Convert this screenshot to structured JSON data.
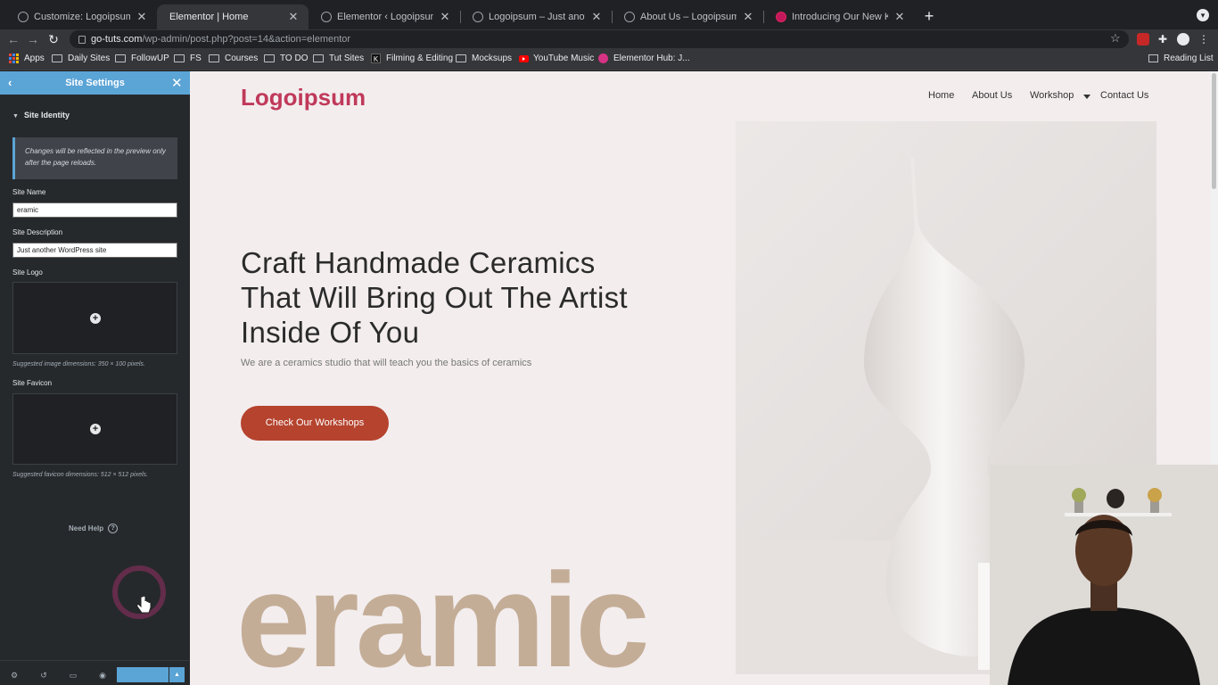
{
  "browser": {
    "tabs": [
      {
        "title": "Customize: Logoipsum – Just a",
        "active": false
      },
      {
        "title": "Elementor | Home",
        "active": true
      },
      {
        "title": "Elementor ‹ Logoipsum — Wo",
        "active": false
      },
      {
        "title": "Logoipsum – Just another Wor",
        "active": false
      },
      {
        "title": "About Us – Logoipsum",
        "active": false
      },
      {
        "title": "Introducing Our New Kits Libra",
        "active": false
      }
    ],
    "url_host": "go-tuts.com",
    "url_path": "/wp-admin/post.php?post=14&action=elementor",
    "bookmarks": [
      {
        "label": "Apps",
        "icon": "apps-grid-icon"
      },
      {
        "label": "Daily Sites",
        "icon": "folder-icon"
      },
      {
        "label": "FollowUP",
        "icon": "folder-icon"
      },
      {
        "label": "FS",
        "icon": "folder-icon"
      },
      {
        "label": "Courses",
        "icon": "folder-icon"
      },
      {
        "label": "TO DO",
        "icon": "folder-icon"
      },
      {
        "label": "Tut Sites",
        "icon": "folder-icon"
      },
      {
        "label": "Filming & Editing",
        "icon": "k-icon"
      },
      {
        "label": "Mocksups",
        "icon": "folder-icon"
      },
      {
        "label": "YouTube Music",
        "icon": "youtube-icon"
      },
      {
        "label": "Elementor Hub: J...",
        "icon": "elementor-icon"
      }
    ],
    "reading_list": "Reading List"
  },
  "panel": {
    "title": "Site Settings",
    "section": "Site Identity",
    "notice": "Changes will be reflected in the preview only after the page reloads.",
    "site_name_label": "Site Name",
    "site_name_value": "eramic",
    "site_description_label": "Site Description",
    "site_description_value": "Just another WordPress site",
    "site_logo_label": "Site Logo",
    "site_logo_hint": "Suggested image dimensions: 350 × 100 pixels.",
    "site_favicon_label": "Site Favicon",
    "site_favicon_hint": "Suggested favicon dimensions: 512 × 512 pixels.",
    "need_help": "Need Help",
    "accent_color": "#5ba4d6"
  },
  "page": {
    "logo": "Logoipsum",
    "nav": [
      "Home",
      "About Us",
      "Workshop",
      "Contact Us"
    ],
    "hero_title": "Craft Handmade Ceramics That Will Bring Out The Artist Inside Of You",
    "hero_subtitle": "We are a ceramics studio that will teach you the basics of ceramics",
    "cta": "Check Our Workshops",
    "big_word": "eramic",
    "brand_color": "#c0395a",
    "cta_color": "#b5432e"
  }
}
